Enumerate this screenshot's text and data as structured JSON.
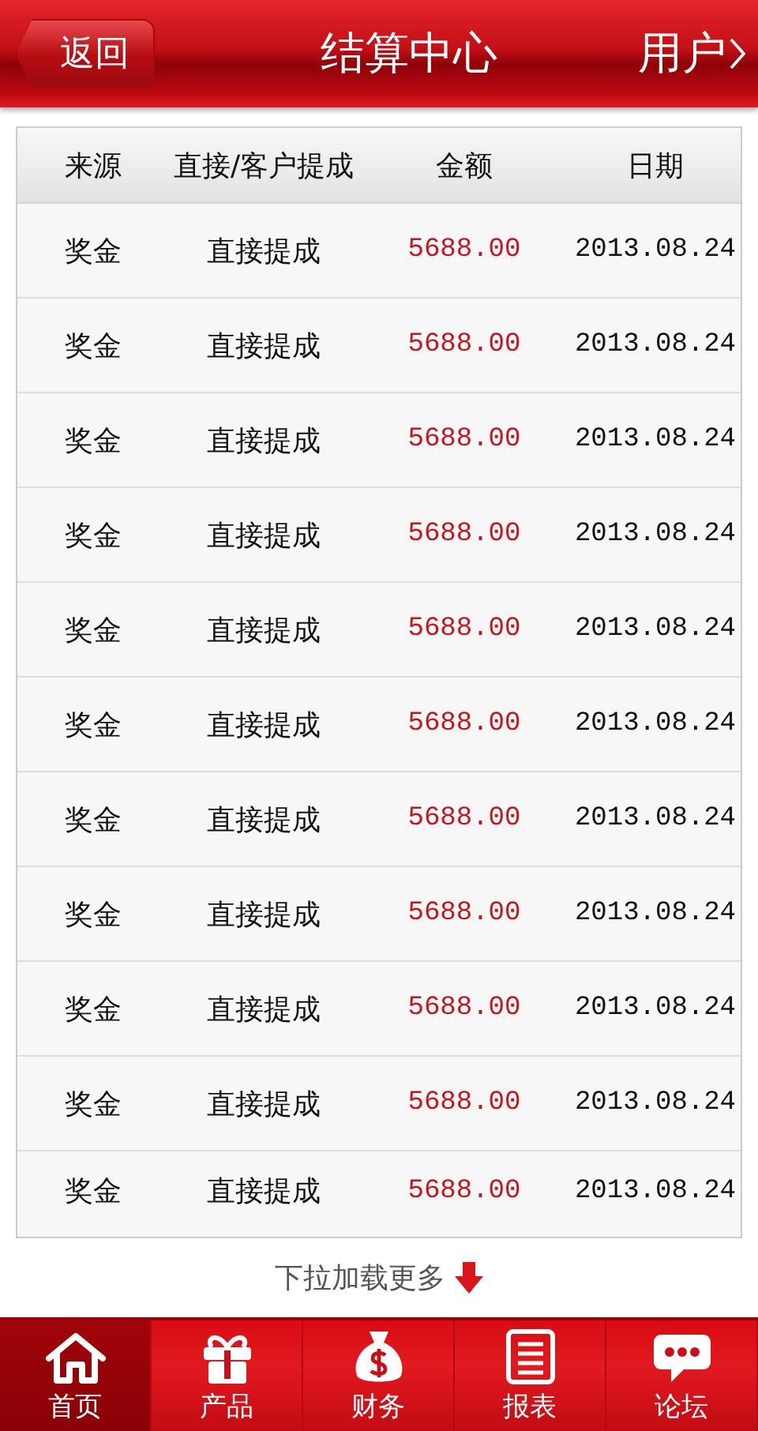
{
  "header": {
    "back": "返回",
    "title": "结算中心",
    "user": "用户"
  },
  "table": {
    "columns": [
      "来源",
      "直接/客户提成",
      "金额",
      "日期"
    ],
    "rows": [
      {
        "source": "奖金",
        "type": "直接提成",
        "amount": "5688.00",
        "date": "2013.08.24"
      },
      {
        "source": "奖金",
        "type": "直接提成",
        "amount": "5688.00",
        "date": "2013.08.24"
      },
      {
        "source": "奖金",
        "type": "直接提成",
        "amount": "5688.00",
        "date": "2013.08.24"
      },
      {
        "source": "奖金",
        "type": "直接提成",
        "amount": "5688.00",
        "date": "2013.08.24"
      },
      {
        "source": "奖金",
        "type": "直接提成",
        "amount": "5688.00",
        "date": "2013.08.24"
      },
      {
        "source": "奖金",
        "type": "直接提成",
        "amount": "5688.00",
        "date": "2013.08.24"
      },
      {
        "source": "奖金",
        "type": "直接提成",
        "amount": "5688.00",
        "date": "2013.08.24"
      },
      {
        "source": "奖金",
        "type": "直接提成",
        "amount": "5688.00",
        "date": "2013.08.24"
      },
      {
        "source": "奖金",
        "type": "直接提成",
        "amount": "5688.00",
        "date": "2013.08.24"
      },
      {
        "source": "奖金",
        "type": "直接提成",
        "amount": "5688.00",
        "date": "2013.08.24"
      },
      {
        "source": "奖金",
        "type": "直接提成",
        "amount": "5688.00",
        "date": "2013.08.24"
      }
    ]
  },
  "load_more": "下拉加载更多",
  "tab_bar": [
    {
      "label": "首页",
      "kind": "home",
      "selected": true
    },
    {
      "label": "产品",
      "kind": "gift",
      "selected": false
    },
    {
      "label": "财务",
      "kind": "money",
      "selected": false
    },
    {
      "label": "报表",
      "kind": "report",
      "selected": false
    },
    {
      "label": "论坛",
      "kind": "chat",
      "selected": false
    }
  ]
}
